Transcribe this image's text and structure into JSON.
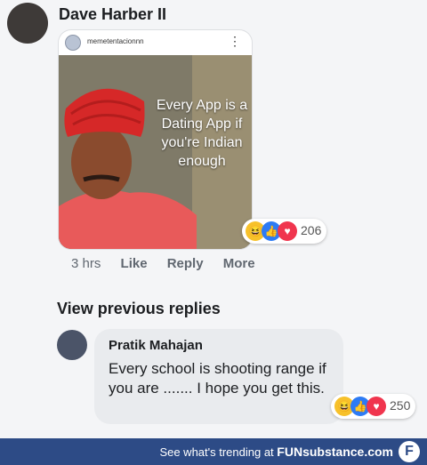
{
  "comment": {
    "author": "Dave Harber II",
    "post": {
      "username": "memetentacionnn",
      "menu_icon": "more-vertical-icon",
      "meme_text": "Every App is a Dating App if you're Indian enough"
    },
    "reactions": {
      "count": "206"
    },
    "actions": {
      "time": "3 hrs",
      "like": "Like",
      "reply": "Reply",
      "more": "More"
    }
  },
  "view_previous_replies": "View previous replies",
  "reply": {
    "author": "Pratik Mahajan",
    "text": "Every school is shooting range if you are ....... I hope you get this.",
    "reactions": {
      "count": "250"
    }
  },
  "footer": {
    "text": "See what's trending at",
    "brand": "FUNsubstance.com",
    "logo": "F"
  },
  "colors": {
    "footer_bg": "#2d4b86",
    "bubble_bg": "#e9ebee",
    "like_blue": "#2d7bf4",
    "love_red": "#f0354e",
    "haha_yellow": "#f7c12a"
  }
}
